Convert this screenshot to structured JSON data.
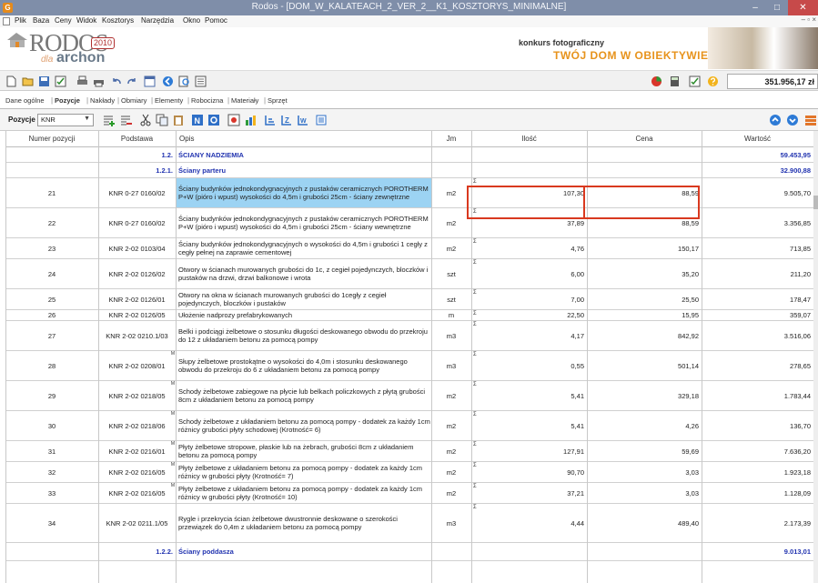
{
  "window": {
    "app_icon": "G",
    "title": "Rodos - [DOM_W_KALATEACH_2_VER_2__K1_KOSZTORYS_MINIMALNE]",
    "min_glyph": "–",
    "max_glyph": "□",
    "close_glyph": "✕"
  },
  "menu": [
    "Plik",
    "Baza",
    "Ceny",
    "Widok",
    "Kosztorys",
    "Narzędzia",
    "Okno",
    "Pomoc"
  ],
  "mdi_controls": "– ▫ ×",
  "banner": {
    "logo": "RODOS",
    "year": "2010",
    "dla": "dla",
    "brand": "archon",
    "promo_small": "konkurs fotograficzny",
    "promo_big": "TWÓJ DOM W OBIEKTYWIE"
  },
  "toolbar": {
    "total": "351.956,17 zł"
  },
  "tabs": [
    "Dane ogólne",
    "Pozycje",
    "Nakłady",
    "Obmiary",
    "Elementy",
    "Robocizna",
    "Materiały",
    "Sprzęt"
  ],
  "pozycje_label": "Pozycje",
  "catalog_select": "KNR",
  "icons": {
    "toolbar1": [
      "new-file-icon",
      "open-folder-icon",
      "save-icon",
      "check-icon",
      "print-preview-icon",
      "print-icon",
      "undo-icon",
      "redo-icon",
      "window-icon",
      "back-icon",
      "zoom-icon",
      "list-icon",
      "pie-chart-icon",
      "calculator-icon",
      "validate-icon",
      "help-icon"
    ],
    "toolbar2": [
      "insert-row-icon",
      "delete-row-icon",
      "cut-icon",
      "copy-icon",
      "paste-icon",
      "new-position-icon",
      "refresh-icon",
      "color-icon",
      "chart-icon",
      "align-left-icon",
      "zoom-z-icon",
      "weight-icon",
      "grid-icon",
      "move-up-icon",
      "move-down-icon",
      "export-icon"
    ]
  },
  "colors": {
    "titlebar": "#7f8ea9",
    "section_text": "#2234b0",
    "selection": "#9cd3f3",
    "highlight": "#d9391f",
    "accent_orange": "#e7931c"
  },
  "table": {
    "headers": [
      "Numer pozycji",
      "Podstawa",
      "Opis",
      "Jm",
      "Ilość",
      "Cena",
      "Wartość"
    ],
    "rows": [
      {
        "type": "section",
        "num": "",
        "base": "1.2.",
        "desc": "ŚCIANY NADZIEMIA",
        "jm": "",
        "qty": "",
        "price": "",
        "value": "59.453,95"
      },
      {
        "type": "section",
        "num": "",
        "base": "1.2.1.",
        "desc": "Ściany parteru",
        "jm": "",
        "qty": "",
        "price": "",
        "value": "32.900,88"
      },
      {
        "type": "item",
        "num": "21",
        "base": "KNR 0-27 0160/02",
        "desc": "Ściany budynków jednokondygnacyjnych z pustaków ceramicznych POROTHERM P+W (pióro i wpust) wysokości do 4,5m i grubości 25cm - ściany zewnętrzne",
        "jm": "m2",
        "qty": "107,30",
        "price": "88,59",
        "value": "9.505,70",
        "sigma": true,
        "mark": false
      },
      {
        "type": "item",
        "num": "22",
        "base": "KNR 0-27 0160/02",
        "desc": "Ściany budynków jednokondygnacyjnych z pustaków ceramicznych POROTHERM P+W (pióro i wpust) wysokości do 4,5m i grubości 25cm - ściany wewnętrzne",
        "jm": "m2",
        "qty": "37,89",
        "price": "88,59",
        "value": "3.356,85",
        "sigma": true,
        "mark": false
      },
      {
        "type": "item",
        "num": "23",
        "base": "KNR 2-02 0103/04",
        "desc": "Ściany budynków jednokondygnacyjnych o wysokości do 4,5m i grubości 1 cegły z cegły pełnej na zaprawie cementowej",
        "jm": "m2",
        "qty": "4,76",
        "price": "150,17",
        "value": "713,85",
        "sigma": true,
        "mark": false
      },
      {
        "type": "item",
        "num": "24",
        "base": "KNR 2-02 0126/02",
        "desc": "Otwory w ścianach murowanych grubości do 1c, z cegieł pojedynczych, bloczków i pustaków na drzwi, drzwi balkonowe i wrota",
        "jm": "szt",
        "qty": "6,00",
        "price": "35,20",
        "value": "211,20",
        "sigma": true,
        "mark": false
      },
      {
        "type": "item",
        "num": "25",
        "base": "KNR 2-02 0126/01",
        "desc": "Otwory na okna w ścianach murowanych grubości do 1cegły z cegieł pojedynczych, bloczków i pustaków",
        "jm": "szt",
        "qty": "7,00",
        "price": "25,50",
        "value": "178,47",
        "sigma": true,
        "mark": false
      },
      {
        "type": "item",
        "num": "26",
        "base": "KNR 2-02 0126/05",
        "desc": "Ułożenie nadprozy prefabrykowanych",
        "jm": "m",
        "qty": "22,50",
        "price": "15,95",
        "value": "359,07",
        "sigma": true,
        "mark": false
      },
      {
        "type": "item",
        "num": "27",
        "base": "KNR 2-02 0210.1/03",
        "desc": "Belki i podciągi żelbetowe o stosunku długości deskowanego obwodu do przekroju do 12 z układaniem betonu za pomocą pompy",
        "jm": "m3",
        "qty": "4,17",
        "price": "842,92",
        "value": "3.516,06",
        "sigma": true,
        "mark": false
      },
      {
        "type": "item",
        "num": "28",
        "base": "KNR 2-02 0208/01",
        "desc": "Słupy żelbetowe prostokątne o wysokości do 4,0m i stosunku deskowanego obwodu do przekroju do 6 z układaniem betonu za pomocą pompy",
        "jm": "m3",
        "qty": "0,55",
        "price": "501,14",
        "value": "278,65",
        "sigma": true,
        "mark": true
      },
      {
        "type": "item",
        "num": "29",
        "base": "KNR 2-02 0218/05",
        "desc": "Schody żelbetowe zabiegowe na płycie lub belkach policzkowych z płytą grubości 8cm z układaniem betonu za pomocą pompy",
        "jm": "m2",
        "qty": "5,41",
        "price": "329,18",
        "value": "1.783,44",
        "sigma": true,
        "mark": true
      },
      {
        "type": "item",
        "num": "30",
        "base": "KNR 2-02 0218/06",
        "desc": "Schody żelbetowe z układaniem betonu za pomocą pompy - dodatek za każdy 1cm różnicy grubości płyty schodowej (Krotność= 6)",
        "jm": "m2",
        "qty": "5,41",
        "price": "4,26",
        "value": "136,70",
        "sigma": true,
        "mark": true
      },
      {
        "type": "item",
        "num": "31",
        "base": "KNR 2-02 0216/01",
        "desc": "Płyty żelbetowe stropowe, płaskie lub na żebrach, grubości 8cm z układaniem betonu za pomocą pompy",
        "jm": "m2",
        "qty": "127,91",
        "price": "59,69",
        "value": "7.636,20",
        "sigma": true,
        "mark": true
      },
      {
        "type": "item",
        "num": "32",
        "base": "KNR 2-02 0216/05",
        "desc": "Płyty żelbetowe z układaniem betonu za pomocą pompy - dodatek za każdy 1cm różnicy w grubości płyty (Krotność= 7)",
        "jm": "m2",
        "qty": "90,70",
        "price": "3,03",
        "value": "1.923,18",
        "sigma": true,
        "mark": true
      },
      {
        "type": "item",
        "num": "33",
        "base": "KNR 2-02 0216/05",
        "desc": "Płyty żelbetowe z układaniem betonu za pomocą pompy - dodatek za każdy 1cm różnicy w grubości płyty (Krotność= 10)",
        "jm": "m2",
        "qty": "37,21",
        "price": "3,03",
        "value": "1.128,09",
        "sigma": true,
        "mark": true
      },
      {
        "type": "item",
        "num": "34",
        "base": "KNR 2-02 0211.1/05",
        "desc": "Rygle i przekrycia ścian żelbetowe dwustronnie deskowane o szerokości przewiązek do 0,4m z układaniem betonu za pomocą pompy",
        "jm": "m3",
        "qty": "4,44",
        "price": "489,40",
        "value": "2.173,39",
        "sigma": true,
        "mark": false
      },
      {
        "type": "section",
        "num": "",
        "base": "1.2.2.",
        "desc": "Ściany poddasza",
        "jm": "",
        "qty": "",
        "price": "",
        "value": "9.013,01"
      }
    ]
  }
}
